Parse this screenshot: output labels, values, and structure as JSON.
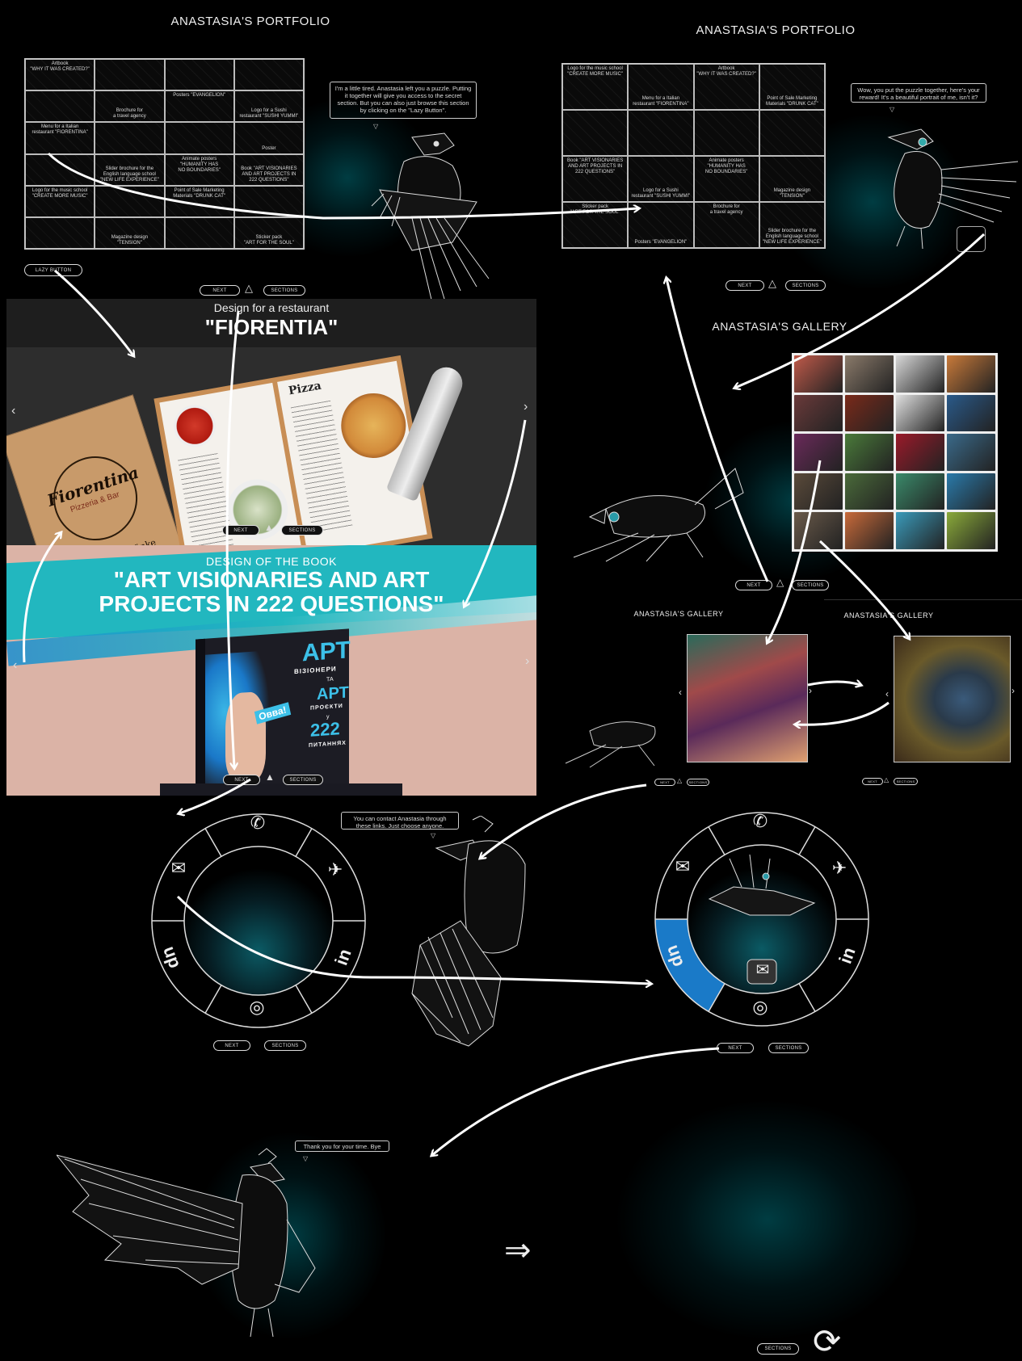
{
  "portfolio_left": {
    "title": "ANASTASIA'S PORTFOLIO",
    "cells": [
      "Artbook\n\"WHY IT WAS CREATED?\"",
      "",
      "",
      "",
      "",
      "Brochure for\na travel agency",
      "Posters \"EVANGELION\"",
      "Logo for a Sushi\nrestaurant \"SUSHI YUMMI\"",
      "Menu for a Italian\nrestaurant \"FIORENTINA\"",
      "",
      "",
      "Poster",
      "",
      "Slider brochure for the\nEnglish language school\n\"NEW LIFE EXPERIENCE\"",
      "Animate posters\n\"HUMANITY HAS\nNO BOUNDARIES\"",
      "Book \"ART VISIONARIES\nAND ART PROJECTS IN\n222 QUESTIONS\"",
      "Logo for the music school\n\"CREATE MORE MUSIC\"",
      "",
      "Point of Sale Marketing\nMaterials \"DRUNK CAT\"",
      "",
      "",
      "Magazine design\n\"TENSION\"",
      "",
      "Sticker pack\n\"ART FOR THE SOUL\""
    ],
    "bubble": "I'm a little tired. Anastasia left you a puzzle. Putting it together will give you access to the secret section. But you can also just browse this section by clicking on the \"Lazy Button\".",
    "lazy_button": "LAZY BUTTON",
    "next": "NEXT",
    "sections": "SECTIONS"
  },
  "portfolio_right": {
    "title": "ANASTASIA'S PORTFOLIO",
    "cells": [
      "Logo for the music school\n\"CREATE MORE MUSIC\"",
      "Menu for a Italian\nrestaurant \"FIORENTINA\"",
      "Artbook\n\"WHY IT WAS CREATED?\"",
      "Point of Sale Marketing\nMaterials \"DRUNK CAT\"",
      "",
      "",
      "",
      "",
      "Book \"ART VISIONARIES\nAND ART PROJECTS IN\n222 QUESTIONS\"",
      "Logo for a Sushi\nrestaurant \"SUSHI YUMMI\"",
      "Animate posters\n\"HUMANITY HAS\nNO BOUNDARIES\"",
      "Magazine design\n\"TENSION\"",
      "Sticker pack\n\"ART FOR THE SOUL\"",
      "Posters \"EVANGELION\"",
      "Brochure for\na travel agency",
      "Slider brochure for the\nEnglish language school\n\"NEW LIFE EXPERIENCE\""
    ],
    "bubble": "Wow, you put the puzzle together, here's your reward! It's a beautiful portrait of me, isn't it?",
    "next": "NEXT",
    "sections": "SECTIONS"
  },
  "restaurant": {
    "subtitle": "Design for a restaurant",
    "title": "\"FIORENTIA\"",
    "brand": "Fiorentina",
    "brand_sub": "Pizzeria & Bar",
    "brand_foot": "Speisen & Getränke",
    "menu_heading": "Pizza",
    "prev": "‹",
    "next_arrow": "›",
    "next": "NEXT",
    "sections": "SECTIONS"
  },
  "book": {
    "subtitle": "DESIGN OF THE BOOK",
    "title_line1": "\"ART VISIONARIES AND ART",
    "title_line2": "PROJECTS IN 222 QUESTIONS\"",
    "cover_title": "АРТ",
    "cover_l2": "ВІЗІОНЕРИ",
    "cover_l3": "ТА",
    "cover_l4": "АРТ",
    "cover_l5": "ПРОЄКТИ",
    "cover_l6": "у",
    "cover_num": "222",
    "cover_l7": "ПИТАННЯХ",
    "cover_sticker": "Овва!",
    "prev": "‹",
    "next_arrow": "›",
    "next": "NEXT",
    "sections": "SECTIONS"
  },
  "gallery": {
    "title": "ANASTASIA'S GALLERY",
    "next": "NEXT",
    "sections": "SECTIONS",
    "thumb_colors": [
      "#c05a4a",
      "#8a7a6a",
      "#d8d8d8",
      "#c97a3a",
      "#6a3a3a",
      "#7a2a1a",
      "#e0e0e0",
      "#2a5a8a",
      "#6a2a5a",
      "#4a7a3a",
      "#9a1a2a",
      "#3a6a8a",
      "#5a4a3a",
      "#4a6a3a",
      "#3a8a6a",
      "#2a7aaa",
      "#6a5a4a",
      "#c86a3a",
      "#3a9aba",
      "#8aaa3a"
    ]
  },
  "gallery_view_left": {
    "title": "ANASTASIA'S GALLERY",
    "next": "NEXT",
    "sections": "SECTIONS"
  },
  "gallery_view_right": {
    "title": "ANASTASIA'S GALLERY",
    "next": "NEXT",
    "sections": "SECTIONS"
  },
  "contact": {
    "bubble": "You can contact Anastasia through these links. Just choose anyone.",
    "next": "NEXT",
    "sections": "SECTIONS",
    "icons": {
      "phone": "✆",
      "telegram": "✈",
      "linkedin": "in",
      "instagram": "◎",
      "upwork": "up",
      "email": "✉"
    },
    "active_color": "#1a7ac8"
  },
  "contact_right": {
    "next": "NEXT",
    "sections": "SECTIONS"
  },
  "farewell": {
    "bubble": "Thank you for your time. Bye",
    "arrow_glyph": "⇒",
    "sections": "SECTIONS",
    "replay_glyph": "⟳"
  },
  "colors": {
    "background": "#000000",
    "teal_glow": "#0a6a74",
    "accent_blue": "#1a7ac8",
    "book_teal": "#22b7bf",
    "book_pink": "#dbb3a6"
  }
}
